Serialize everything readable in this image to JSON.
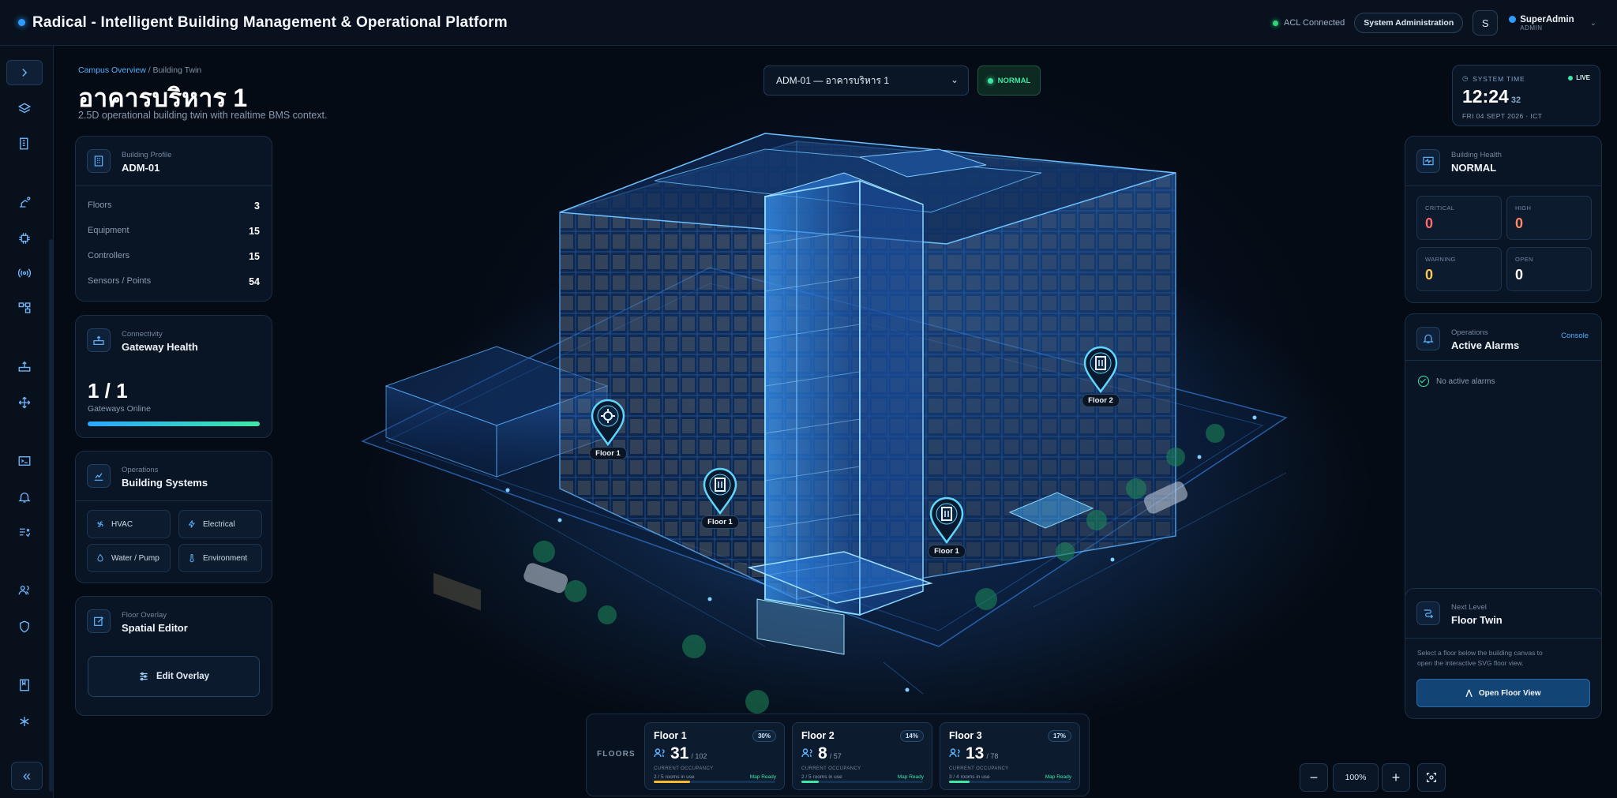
{
  "header": {
    "title": "Radical - Intelligent Building Management & Operational Platform",
    "acl_status": "ACL Connected",
    "system_admin_label": "System Administration",
    "avatar_letter": "S",
    "user_name": "SuperAdmin",
    "user_role": "ADMIN"
  },
  "sidebar": {
    "icons": [
      "expand-icon",
      "layers-icon",
      "building-icon",
      "robot-arm-icon",
      "chip-icon",
      "broadcast-icon",
      "network-icon",
      "router-icon",
      "move-icon",
      "terminal-icon",
      "bell-icon",
      "checklist-icon",
      "users-icon",
      "shield-icon",
      "book-icon",
      "asterisk-icon"
    ],
    "collapse_icon": "double-chevron-left-icon"
  },
  "page": {
    "breadcrumb_root": "Campus Overview",
    "breadcrumb_sep": " / ",
    "breadcrumb_current": "Building Twin",
    "title": "อาคารบริหาร 1",
    "subtitle": "2.5D operational building twin with realtime BMS context."
  },
  "building_select": {
    "value": "ADM-01 — อาคารบริหาร 1",
    "status": "NORMAL"
  },
  "system_time": {
    "label": "SYSTEM TIME",
    "live": "LIVE",
    "time": "12:24",
    "seconds": "32",
    "date": "FRI 04 SEPT 2026 · ICT"
  },
  "building_profile": {
    "caption": "Building Profile",
    "title": "ADM-01",
    "rows": [
      {
        "label": "Floors",
        "value": "3"
      },
      {
        "label": "Equipment",
        "value": "15"
      },
      {
        "label": "Controllers",
        "value": "15"
      },
      {
        "label": "Sensors / Points",
        "value": "54"
      }
    ]
  },
  "gateway": {
    "caption": "Connectivity",
    "title": "Gateway Health",
    "value": "1 / 1",
    "label": "Gateways Online",
    "online_ratio": 1.0
  },
  "building_systems": {
    "caption": "Operations",
    "title": "Building Systems",
    "items": [
      "HVAC",
      "Electrical",
      "Water / Pump",
      "Environment"
    ]
  },
  "spatial_editor": {
    "caption": "Floor Overlay",
    "title": "Spatial Editor",
    "button": "Edit Overlay"
  },
  "building_health": {
    "caption": "Building Health",
    "title": "NORMAL",
    "stats": [
      {
        "label": "CRITICAL",
        "value": "0",
        "color": "#ff6b6b"
      },
      {
        "label": "HIGH",
        "value": "0",
        "color": "#ff8a65"
      },
      {
        "label": "WARNING",
        "value": "0",
        "color": "#ffc857"
      },
      {
        "label": "OPEN",
        "value": "0",
        "color": "#ffffff"
      }
    ]
  },
  "alarms": {
    "caption": "Operations",
    "title": "Active Alarms",
    "console_link": "Console",
    "empty_text": "No active alarms"
  },
  "floor_twin": {
    "caption": "Next Level",
    "title": "Floor Twin",
    "description": "Select a floor below the building canvas to open the interactive SVG floor view.",
    "button": "Open Floor View"
  },
  "pins": [
    {
      "label": "Floor 1",
      "icon": "gear-icon"
    },
    {
      "label": "Floor 1",
      "icon": "door-icon"
    },
    {
      "label": "Floor 1",
      "icon": "door-icon"
    },
    {
      "label": "Floor 2",
      "icon": "door-icon"
    }
  ],
  "floors": {
    "label": "FLOORS",
    "occupancy_label": "CURRENT OCCUPANCY",
    "status_label": "Map Ready",
    "items": [
      {
        "name": "Floor 1",
        "pct": "30%",
        "occupancy": "31",
        "capacity": "/ 102",
        "rooms": "2 / 5 rooms in use",
        "fill": 0.3,
        "color": "#f5b82e"
      },
      {
        "name": "Floor 2",
        "pct": "14%",
        "occupancy": "8",
        "capacity": "/ 57",
        "rooms": "2 / 5 rooms in use",
        "fill": 0.14,
        "color": "#3ee6a5"
      },
      {
        "name": "Floor 3",
        "pct": "17%",
        "occupancy": "13",
        "capacity": "/ 78",
        "rooms": "3 / 4 rooms in use",
        "fill": 0.17,
        "color": "#3ee6a5"
      }
    ]
  },
  "zoom": {
    "value": "100%",
    "minus": "−",
    "plus": "+"
  }
}
